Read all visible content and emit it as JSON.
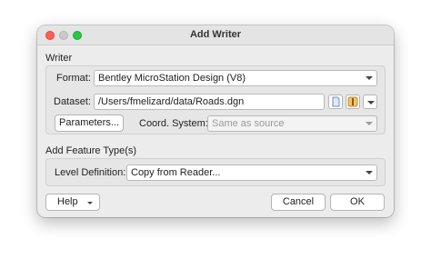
{
  "window": {
    "title": "Add Writer"
  },
  "writer_section": {
    "label": "Writer",
    "format_label": "Format:",
    "format_value": "Bentley MicroStation Design (V8)",
    "dataset_label": "Dataset:",
    "dataset_value": "/Users/fmelizard/data/Roads.dgn",
    "parameters_label": "Parameters...",
    "coord_system_label": "Coord. System:",
    "coord_system_value": "Same as source"
  },
  "feature_section": {
    "label": "Add Feature Type(s)",
    "level_definition_label": "Level Definition:",
    "level_definition_value": "Copy from Reader..."
  },
  "footer": {
    "help_label": "Help",
    "cancel_label": "Cancel",
    "ok_label": "OK"
  },
  "colors": {
    "close": "#ff5f57",
    "minimize": "#c9c9c9",
    "maximize": "#28c840"
  }
}
